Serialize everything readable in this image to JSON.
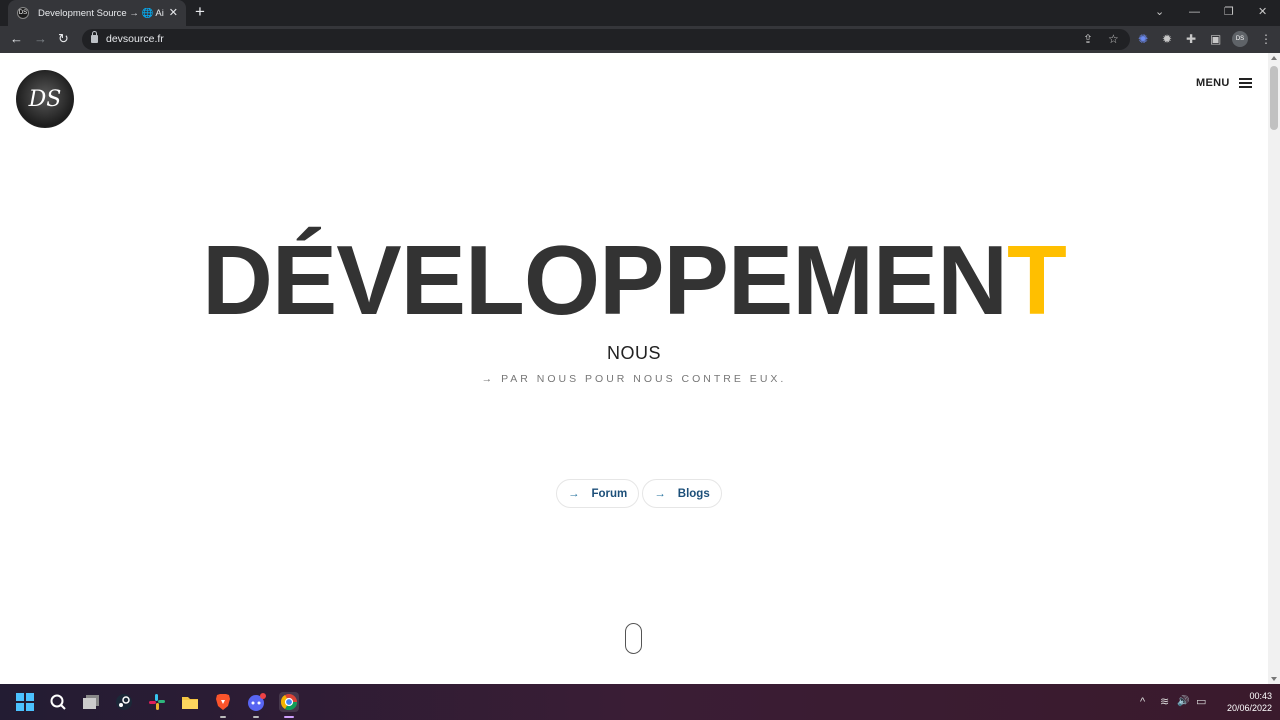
{
  "browser": {
    "tab": {
      "title": "Development Source → 🌐 Aide…",
      "favicon_text": "DS",
      "close": "✕"
    },
    "new_tab": "+",
    "window_controls": {
      "dropdown": "⌄",
      "minimize": "—",
      "restore": "❐",
      "close": "✕"
    },
    "nav": {
      "back": "←",
      "forward": "→",
      "reload": "↻"
    },
    "url": "devsource.fr",
    "omnibox_icons": {
      "share": "⇪",
      "bookmark": "☆"
    },
    "toolbar_icons": {
      "ext1": "✺",
      "ext2": "✹",
      "puzzle": "✚",
      "sidepanel": "▣",
      "profile": "DS",
      "menu": "⋮"
    }
  },
  "site": {
    "logo_text": "DS",
    "menu_label": "MENU",
    "hero": {
      "title_main": "DÉVELOPPEMEN",
      "title_accent": "T",
      "subtitle": "NOUS",
      "tagline": "→ PAR NOUS POUR NOUS CONTRE EUX."
    },
    "buttons": [
      {
        "arrow": "→",
        "label": "Forum"
      },
      {
        "arrow": "→",
        "label": "Blogs"
      }
    ],
    "colors": {
      "accent": "#ffbf00",
      "title": "#333333",
      "link": "#1c4f79"
    }
  },
  "taskbar": {
    "apps": [
      "start-icon",
      "search-icon",
      "taskview-icon",
      "steam-icon",
      "slack-icon",
      "file-explorer-icon",
      "brave-icon",
      "discord-icon",
      "chrome-icon"
    ],
    "tray": {
      "chevron": "^",
      "wifi": "≋",
      "volume": "🔊",
      "battery": "▭"
    },
    "time": "00:43",
    "date": "20/06/2022"
  }
}
